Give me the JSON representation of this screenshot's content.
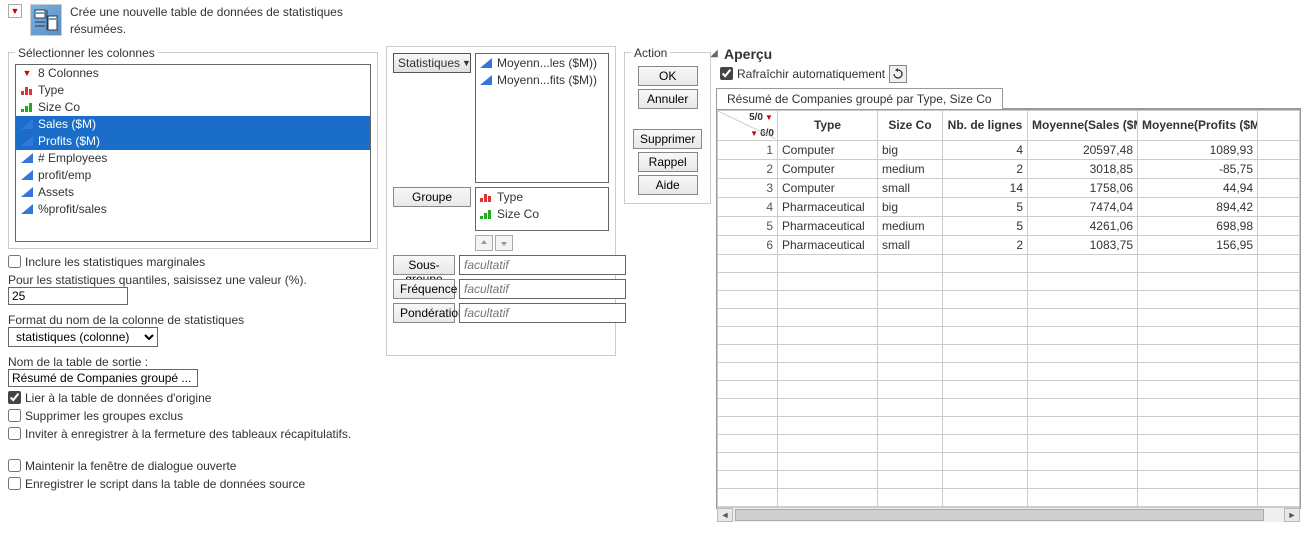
{
  "header": {
    "description": "Crée une nouvelle table de données de statistiques résumées."
  },
  "columns_panel": {
    "title": "Sélectionner les colonnes",
    "count_label": "8 Colonnes",
    "items": [
      {
        "name": "Type",
        "icon": "nominal-red"
      },
      {
        "name": "Size Co",
        "icon": "ordinal-green"
      },
      {
        "name": "Sales ($M)",
        "icon": "continuous-blue",
        "selected": true
      },
      {
        "name": "Profits ($M)",
        "icon": "continuous-blue",
        "selected": true
      },
      {
        "name": "# Employees",
        "icon": "continuous-blue"
      },
      {
        "name": "profit/emp",
        "icon": "continuous-blue"
      },
      {
        "name": "Assets",
        "icon": "continuous-blue"
      },
      {
        "name": "%profit/sales",
        "icon": "continuous-blue"
      }
    ],
    "marginal_label": "Inclure les statistiques marginales",
    "quantile_label": "Pour les statistiques quantiles, saisissez une valeur (%).",
    "quantile_value": "25",
    "format_label": "Format du nom de la colonne de statistiques",
    "format_value": "statistiques (colonne)",
    "output_name_label": "Nom de la table de sortie :",
    "output_name_value": "Résumé de Companies groupé ...",
    "link_label": "Lier à la table de données d'origine",
    "link_checked": true,
    "suppress_label": "Supprimer les groupes exclus",
    "prompt_save_label": "Inviter à enregistrer à la fermeture des tableaux récapitulatifs.",
    "keep_open_label": "Maintenir la fenêtre de dialogue ouverte",
    "save_script_label": "Enregistrer le script dans la table de données source"
  },
  "roles": {
    "stats_label": "Statistiques",
    "stats_items": [
      {
        "label": "Moyenn...les ($M))",
        "icon": "continuous-blue"
      },
      {
        "label": "Moyenn...fits ($M))",
        "icon": "continuous-blue"
      }
    ],
    "group_label": "Groupe",
    "group_items": [
      {
        "label": "Type",
        "icon": "nominal-red"
      },
      {
        "label": "Size Co",
        "icon": "ordinal-green"
      }
    ],
    "subgroup_label": "Sous-groupe",
    "freq_label": "Fréquence",
    "weight_label": "Pondération",
    "optional_placeholder": "facultatif"
  },
  "action": {
    "title": "Action",
    "ok": "OK",
    "cancel": "Annuler",
    "remove": "Supprimer",
    "recall": "Rappel",
    "help": "Aide"
  },
  "preview": {
    "title": "Aperçu",
    "refresh_label": "Rafraîchir automatiquement",
    "refresh_checked": true,
    "tab_label": "Résumé de Companies groupé par Type, Size Co",
    "corner_top": "5/0",
    "corner_bottom": "6/0",
    "columns": [
      "Type",
      "Size Co",
      "Nb. de lignes",
      "Moyenne(Sales ($M))",
      "Moyenne(Profits ($M))"
    ],
    "rows": [
      {
        "n": 1,
        "Type": "Computer",
        "SizeCo": "big",
        "Nb": 4,
        "MeanSales": "20597,48",
        "MeanProfits": "1089,93"
      },
      {
        "n": 2,
        "Type": "Computer",
        "SizeCo": "medium",
        "Nb": 2,
        "MeanSales": "3018,85",
        "MeanProfits": "-85,75"
      },
      {
        "n": 3,
        "Type": "Computer",
        "SizeCo": "small",
        "Nb": 14,
        "MeanSales": "1758,06",
        "MeanProfits": "44,94"
      },
      {
        "n": 4,
        "Type": "Pharmaceutical",
        "SizeCo": "big",
        "Nb": 5,
        "MeanSales": "7474,04",
        "MeanProfits": "894,42"
      },
      {
        "n": 5,
        "Type": "Pharmaceutical",
        "SizeCo": "medium",
        "Nb": 5,
        "MeanSales": "4261,06",
        "MeanProfits": "698,98"
      },
      {
        "n": 6,
        "Type": "Pharmaceutical",
        "SizeCo": "small",
        "Nb": 2,
        "MeanSales": "1083,75",
        "MeanProfits": "156,95"
      }
    ]
  }
}
